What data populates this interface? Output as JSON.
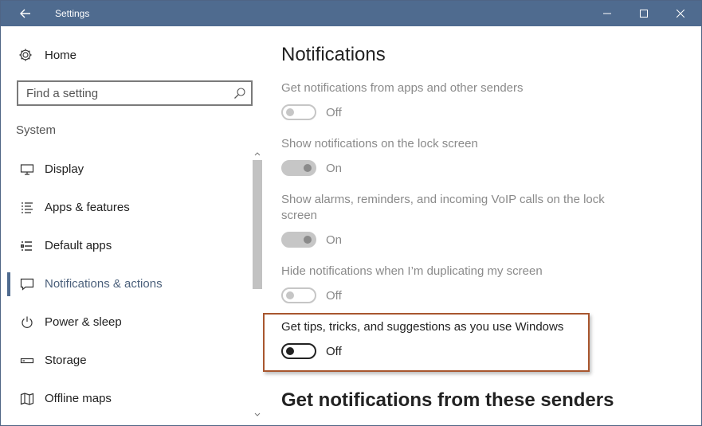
{
  "window": {
    "title": "Settings"
  },
  "sidebar": {
    "home_label": "Home",
    "search": {
      "placeholder": "Find a setting"
    },
    "section_title": "System",
    "items": [
      {
        "label": "Display",
        "icon": "display-icon"
      },
      {
        "label": "Apps & features",
        "icon": "apps-list-icon"
      },
      {
        "label": "Default apps",
        "icon": "default-apps-icon"
      },
      {
        "label": "Notifications & actions",
        "icon": "notifications-icon",
        "selected": true
      },
      {
        "label": "Power & sleep",
        "icon": "power-icon"
      },
      {
        "label": "Storage",
        "icon": "storage-icon"
      },
      {
        "label": "Offline maps",
        "icon": "map-icon"
      }
    ]
  },
  "main": {
    "title": "Notifications",
    "settings": [
      {
        "label": "Get notifications from apps and other senders",
        "state": "Off"
      },
      {
        "label": "Show notifications on the lock screen",
        "state": "On"
      },
      {
        "label": "Show alarms, reminders, and incoming VoIP calls on the lock screen",
        "state": "On"
      },
      {
        "label": "Hide notifications when I’m duplicating my screen",
        "state": "Off"
      },
      {
        "label": "Get tips, tricks, and suggestions as you use Windows",
        "state": "Off"
      }
    ],
    "subheading": "Get notifications from these senders"
  },
  "colors": {
    "titlebar": "#4f6b8f",
    "highlight_border": "#a8562e",
    "disabled_text": "#8a8a8a"
  }
}
